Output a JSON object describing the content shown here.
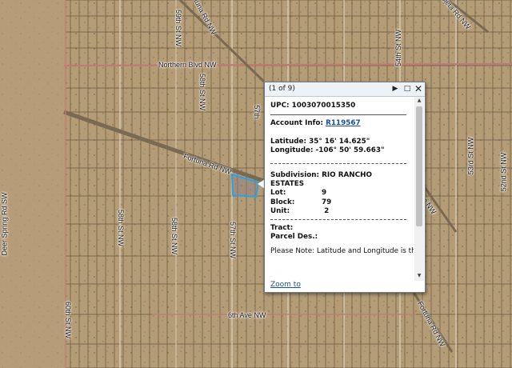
{
  "map": {
    "colors": {
      "ground": "#b49c76",
      "lot_lines": "#5c4b36",
      "major_road": "#c07a72",
      "highlight": "#2ba3e0"
    },
    "road_labels": {
      "northern_blvd": "Northern Blvd NW",
      "fortuna_rd_upper": "Fortuna Rd NW",
      "fortuna_rd_lower": "Fortuna Rd NW",
      "sixth_ave": "6th Ave NW",
      "deer_spring_rd": "Deer Spring Rd SW",
      "sixtieth_st": "60th St NW",
      "fifty_ninth_st_top": "59th St NW",
      "fifty_eighth_st_mid": "58th St NW",
      "fifty_eighth_st_low": "58th St NW",
      "fifty_eighth_st_low2": "58th St NW",
      "fifty_seventh_st": "57th St NW",
      "fifty_seventh_st_mid": "57th",
      "fifty_fourth_st": "54th St NW",
      "fifty_third_st": "53rd St NW",
      "fifty_second_st": "52nd St NW",
      "top_left_road": "Fortuna Rd NW",
      "top_right_road": "Isleta Rd NW",
      "right_mid_road": "Tiwi NW"
    }
  },
  "popup": {
    "counter": "(1 of 9)",
    "next_icon": "▶",
    "maximize_icon": "□",
    "close_icon": "✕",
    "upc_label": "UPC:",
    "upc_value": "1003070015350",
    "account_label": "Account Info:",
    "account_value": "R119567",
    "latitude_label": "Latitude:",
    "latitude_value": "35° 16' 14.625\"",
    "longitude_label": "Longitude:",
    "longitude_value": "-106° 50' 59.663\"",
    "subdivision_label": "Subdivision:",
    "subdivision_value_1": "RIO RANCHO",
    "subdivision_value_2": "ESTATES",
    "lot_label": "Lot:",
    "lot_value": "9",
    "block_label": "Block:",
    "block_value": "79",
    "unit_label": "Unit:",
    "unit_value": "2",
    "tract_label": "Tract:",
    "parcel_label": "Parcel Des.:",
    "note": "Please Note: Latitude and Longitude is the approximate center of the parcel shown.",
    "zoom_link": "Zoom to"
  }
}
